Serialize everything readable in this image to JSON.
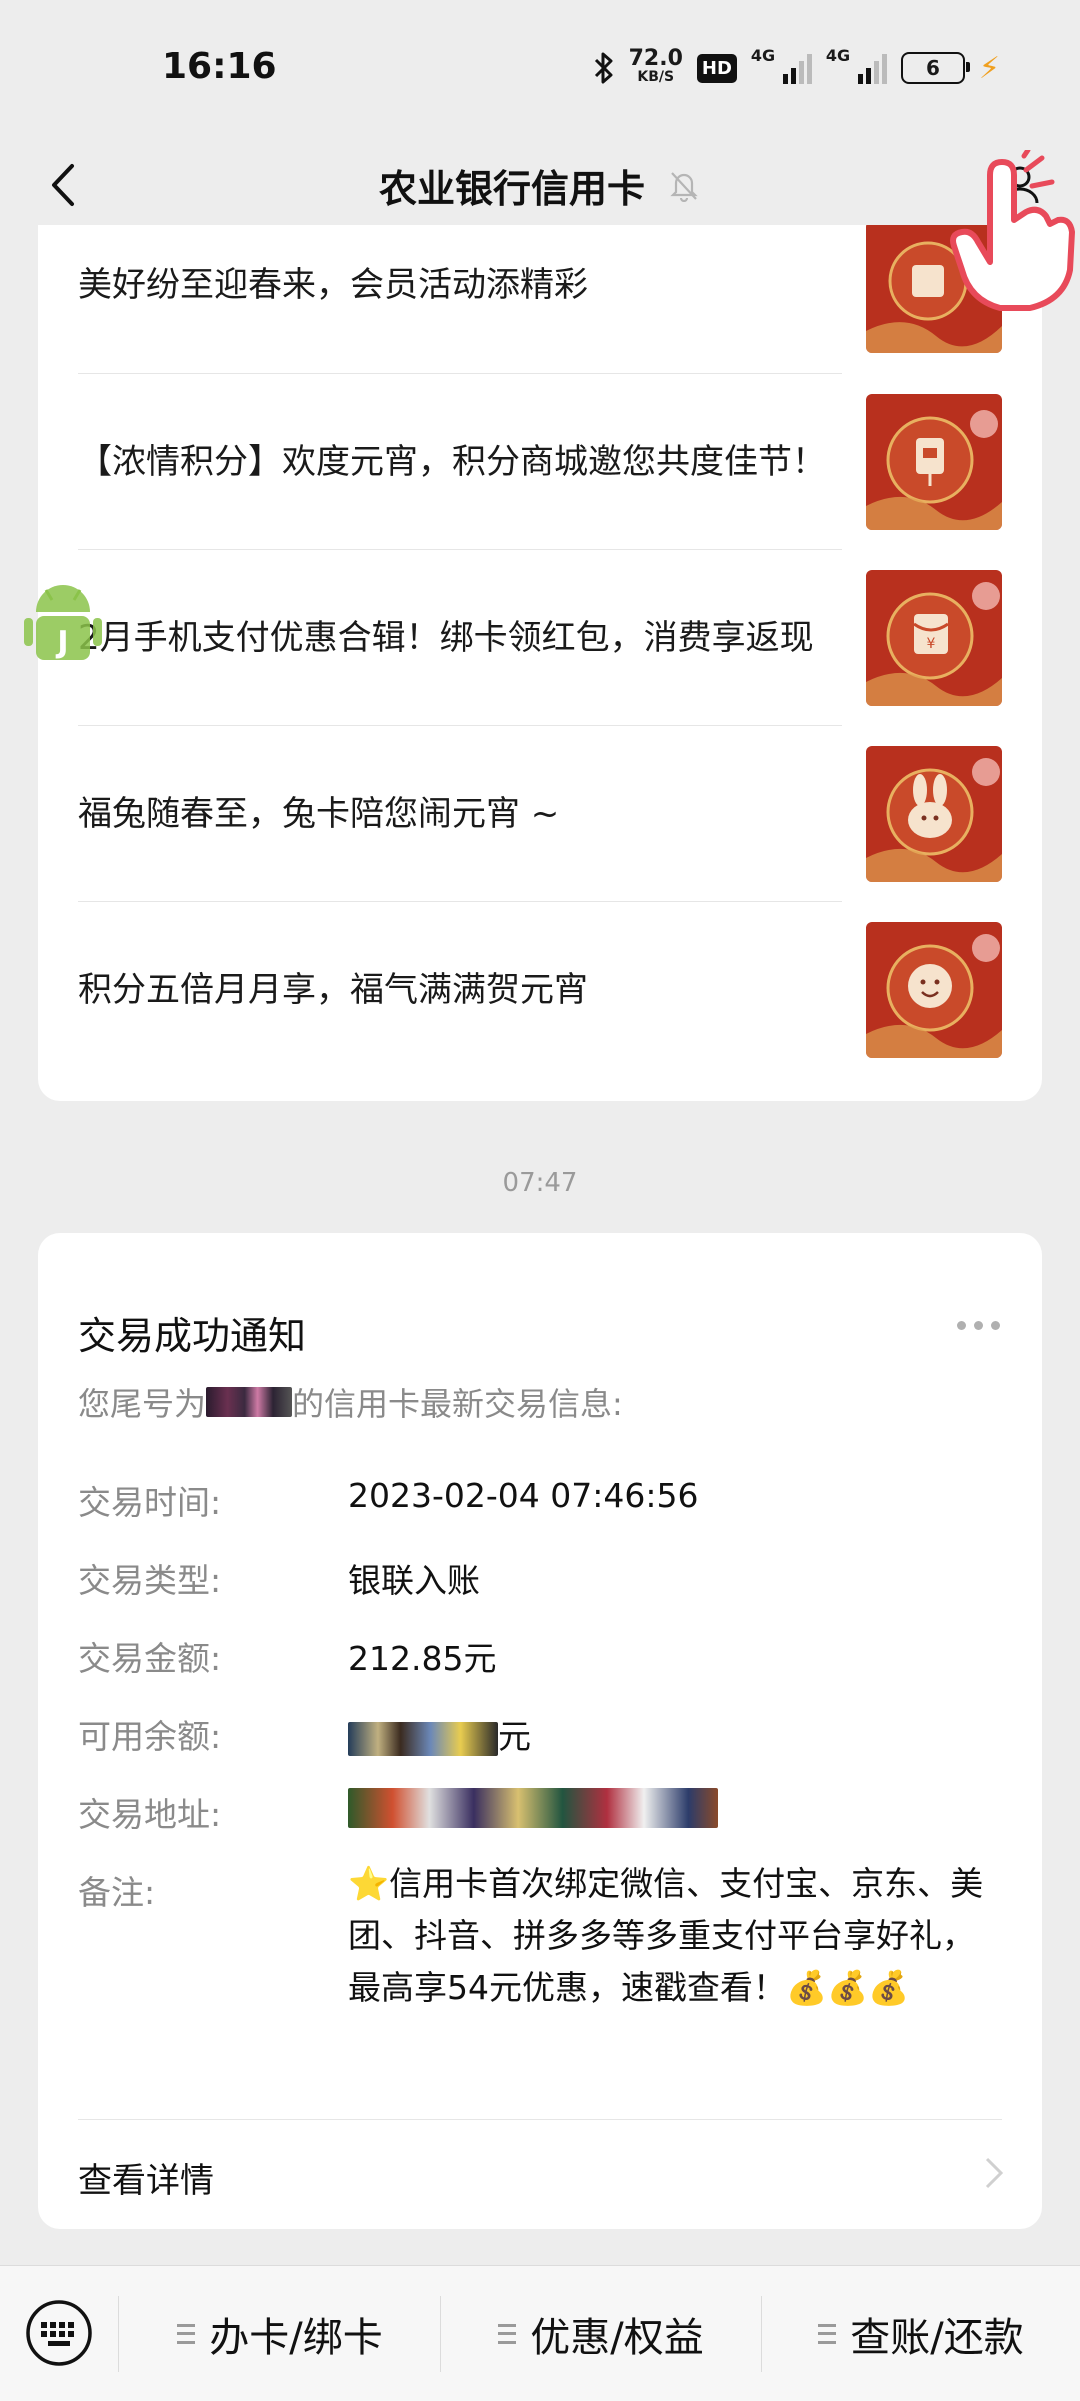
{
  "status_bar": {
    "time": "16:16",
    "net_speed": "72.0",
    "net_speed_unit": "KB/S",
    "hd": "HD",
    "sim1": "4G",
    "sim2": "4G",
    "battery": "6"
  },
  "nav": {
    "title": "农业银行信用卡"
  },
  "articles": [
    {
      "text": "美好纷至迎春来，会员活动添精彩",
      "thumb_icon": "gift-icon"
    },
    {
      "text": "【浓情积分】欢度元宵，积分商城邀您共度佳节！",
      "thumb_icon": "gift-icon"
    },
    {
      "text": "2月手机支付优惠合辑！绑卡领红包，消费享返现",
      "thumb_icon": "red-envelope-icon"
    },
    {
      "text": "福兔随春至，兔卡陪您闹元宵 ~",
      "thumb_icon": "rabbit-icon"
    },
    {
      "text": "积分五倍月月享，福气满满贺元宵",
      "thumb_icon": "smile-icon"
    }
  ],
  "time_label": "07:47",
  "transaction": {
    "title": "交易成功通知",
    "subtitle_prefix": "您尾号为",
    "subtitle_suffix": "的信用卡最新交易信息:",
    "rows": [
      {
        "label": "交易时间:",
        "value": "2023-02-04 07:46:56"
      },
      {
        "label": "交易类型:",
        "value": "银联入账"
      },
      {
        "label": "交易金额:",
        "value": "212.85元"
      },
      {
        "label": "可用余额:",
        "value_suffix": "元"
      },
      {
        "label": "交易地址:"
      }
    ],
    "note_label": "备注:",
    "note_text": "⭐信用卡首次绑定微信、支付宝、京东、美团、抖音、拼多多等多重支付平台享好礼，最高享54元优惠，速戳查看！💰💰💰",
    "detail_link": "查看详情"
  },
  "bottom_menu": [
    {
      "label": "办卡/绑卡"
    },
    {
      "label": "优惠/权益"
    },
    {
      "label": "查账/还款"
    }
  ],
  "colors": {
    "note_red": "#e02a2a",
    "thumb_red": "#b8301e",
    "background": "#ededed"
  }
}
